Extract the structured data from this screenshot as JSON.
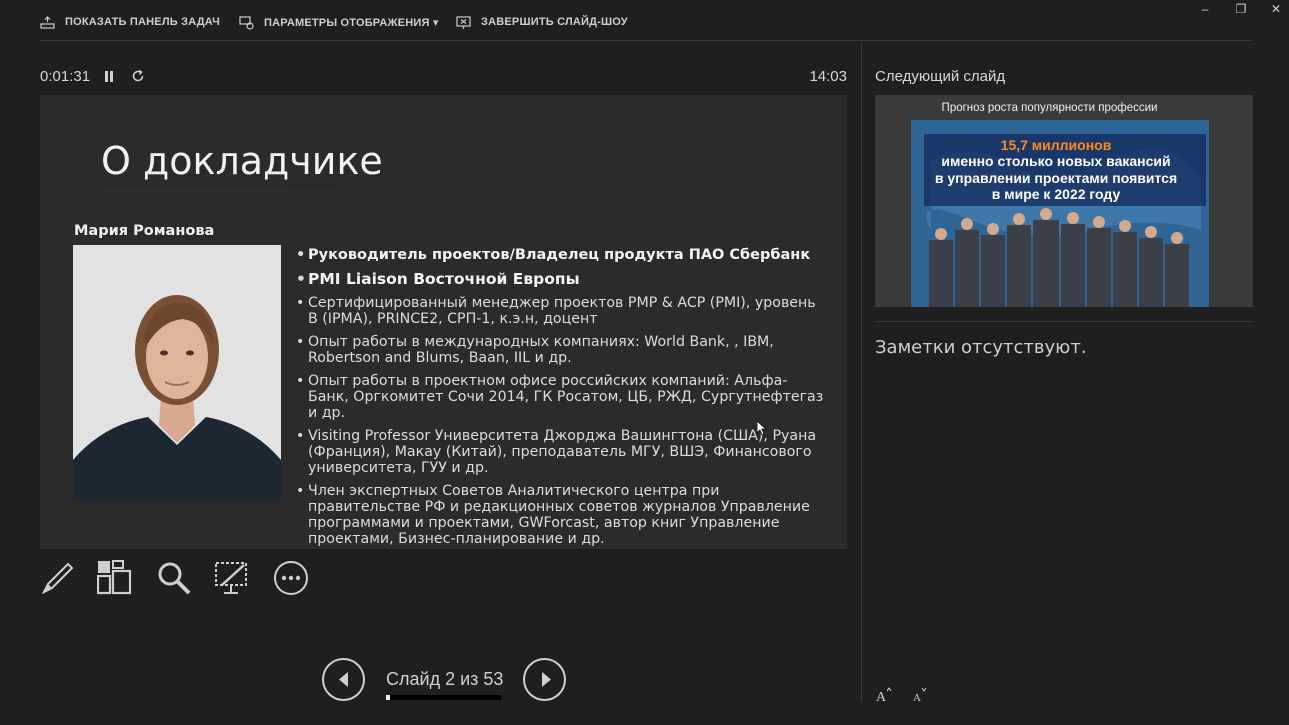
{
  "toolbar": {
    "show_taskbar": "ПОКАЗАТЬ ПАНЕЛЬ ЗАДАЧ",
    "display_settings": "ПАРАМЕТРЫ ОТОБРАЖЕНИЯ ▾",
    "end_slideshow": "ЗАВЕРШИТЬ СЛАЙД-ШОУ"
  },
  "window_controls": {
    "minimize": "–",
    "restore": "❐",
    "close": "✕"
  },
  "timer": {
    "elapsed": "0:01:31",
    "clock": "14:03"
  },
  "slide": {
    "title": "О докладчике",
    "speaker_name": "Мария Романова",
    "bullets": [
      "Руководитель проектов/Владелец продукта ПАО Сбербанк",
      "PMI Liaison Восточной Европы",
      "Сертифицированный менеджер проектов PMP & ACP (PMI), уровень В (IPMA), PRINCE2, СРП-1, к.э.н, доцент",
      "Опыт работы в международных компаниях: World Bank, , IBM, Robertson and Blums, Baan, IIL и др.",
      "Опыт работы в проектном офисе российских компаний: Альфа-Банк, Оргкомитет Сочи 2014, ГК Росатом, ЦБ, РЖД, Сургутнефтегаз и др.",
      "Visiting Professor Университета Джорджа Вашингтона (США), Руана (Франция), Макау (Китай), преподаватель МГУ, ВШЭ, Финансового университета, ГУУ и др.",
      "Член экспертных Советов Аналитического центра при правительстве РФ и редакционных советов журналов Управление программами и проектами, GWForcast, автор книг Управление проектами, Бизнес-планирование и др."
    ]
  },
  "tools": [
    "pen-icon",
    "slides-grid-icon",
    "zoom-icon",
    "pointer-screen-icon",
    "more-options-icon"
  ],
  "navigation": {
    "counter": "Слайд 2 из 53",
    "progress": 0.038
  },
  "next_slide": {
    "label": "Следующий слайд",
    "title": "Прогноз роста популярности профессии",
    "banner_lines": [
      "15,7 миллионов",
      "именно столько новых вакансий",
      "в управлении проектами появится",
      "в мире к 2022 году"
    ]
  },
  "notes": {
    "text": "Заметки отсутствуют."
  },
  "font_controls": {
    "increase": "A",
    "decrease": "A"
  },
  "colors": {
    "background": "#1f1f1f",
    "slide_bg": "#2b2b2b",
    "accent_orange": "#ff8a1e"
  }
}
